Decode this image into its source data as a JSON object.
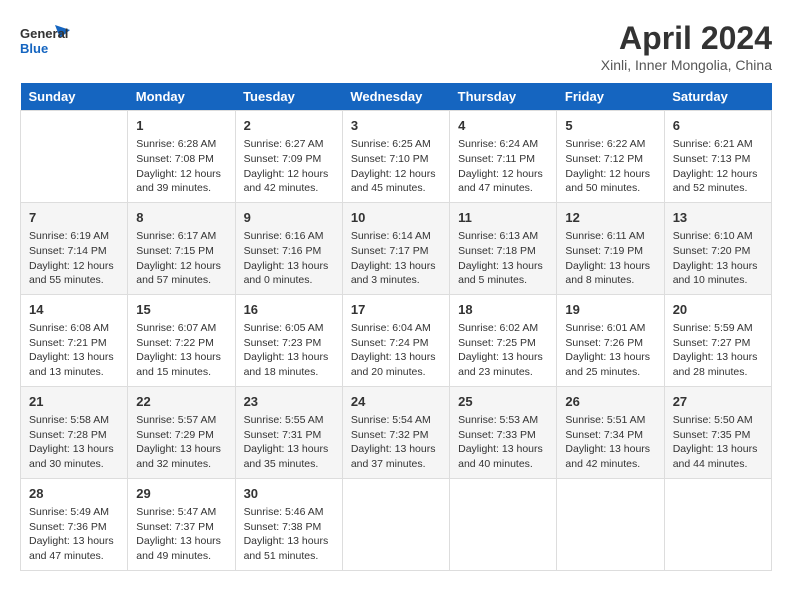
{
  "header": {
    "logo_line1": "General",
    "logo_line2": "Blue",
    "title": "April 2024",
    "subtitle": "Xinli, Inner Mongolia, China"
  },
  "days_of_week": [
    "Sunday",
    "Monday",
    "Tuesday",
    "Wednesday",
    "Thursday",
    "Friday",
    "Saturday"
  ],
  "weeks": [
    [
      {
        "day": "",
        "content": ""
      },
      {
        "day": "1",
        "content": "Sunrise: 6:28 AM\nSunset: 7:08 PM\nDaylight: 12 hours\nand 39 minutes."
      },
      {
        "day": "2",
        "content": "Sunrise: 6:27 AM\nSunset: 7:09 PM\nDaylight: 12 hours\nand 42 minutes."
      },
      {
        "day": "3",
        "content": "Sunrise: 6:25 AM\nSunset: 7:10 PM\nDaylight: 12 hours\nand 45 minutes."
      },
      {
        "day": "4",
        "content": "Sunrise: 6:24 AM\nSunset: 7:11 PM\nDaylight: 12 hours\nand 47 minutes."
      },
      {
        "day": "5",
        "content": "Sunrise: 6:22 AM\nSunset: 7:12 PM\nDaylight: 12 hours\nand 50 minutes."
      },
      {
        "day": "6",
        "content": "Sunrise: 6:21 AM\nSunset: 7:13 PM\nDaylight: 12 hours\nand 52 minutes."
      }
    ],
    [
      {
        "day": "7",
        "content": "Sunrise: 6:19 AM\nSunset: 7:14 PM\nDaylight: 12 hours\nand 55 minutes."
      },
      {
        "day": "8",
        "content": "Sunrise: 6:17 AM\nSunset: 7:15 PM\nDaylight: 12 hours\nand 57 minutes."
      },
      {
        "day": "9",
        "content": "Sunrise: 6:16 AM\nSunset: 7:16 PM\nDaylight: 13 hours\nand 0 minutes."
      },
      {
        "day": "10",
        "content": "Sunrise: 6:14 AM\nSunset: 7:17 PM\nDaylight: 13 hours\nand 3 minutes."
      },
      {
        "day": "11",
        "content": "Sunrise: 6:13 AM\nSunset: 7:18 PM\nDaylight: 13 hours\nand 5 minutes."
      },
      {
        "day": "12",
        "content": "Sunrise: 6:11 AM\nSunset: 7:19 PM\nDaylight: 13 hours\nand 8 minutes."
      },
      {
        "day": "13",
        "content": "Sunrise: 6:10 AM\nSunset: 7:20 PM\nDaylight: 13 hours\nand 10 minutes."
      }
    ],
    [
      {
        "day": "14",
        "content": "Sunrise: 6:08 AM\nSunset: 7:21 PM\nDaylight: 13 hours\nand 13 minutes."
      },
      {
        "day": "15",
        "content": "Sunrise: 6:07 AM\nSunset: 7:22 PM\nDaylight: 13 hours\nand 15 minutes."
      },
      {
        "day": "16",
        "content": "Sunrise: 6:05 AM\nSunset: 7:23 PM\nDaylight: 13 hours\nand 18 minutes."
      },
      {
        "day": "17",
        "content": "Sunrise: 6:04 AM\nSunset: 7:24 PM\nDaylight: 13 hours\nand 20 minutes."
      },
      {
        "day": "18",
        "content": "Sunrise: 6:02 AM\nSunset: 7:25 PM\nDaylight: 13 hours\nand 23 minutes."
      },
      {
        "day": "19",
        "content": "Sunrise: 6:01 AM\nSunset: 7:26 PM\nDaylight: 13 hours\nand 25 minutes."
      },
      {
        "day": "20",
        "content": "Sunrise: 5:59 AM\nSunset: 7:27 PM\nDaylight: 13 hours\nand 28 minutes."
      }
    ],
    [
      {
        "day": "21",
        "content": "Sunrise: 5:58 AM\nSunset: 7:28 PM\nDaylight: 13 hours\nand 30 minutes."
      },
      {
        "day": "22",
        "content": "Sunrise: 5:57 AM\nSunset: 7:29 PM\nDaylight: 13 hours\nand 32 minutes."
      },
      {
        "day": "23",
        "content": "Sunrise: 5:55 AM\nSunset: 7:31 PM\nDaylight: 13 hours\nand 35 minutes."
      },
      {
        "day": "24",
        "content": "Sunrise: 5:54 AM\nSunset: 7:32 PM\nDaylight: 13 hours\nand 37 minutes."
      },
      {
        "day": "25",
        "content": "Sunrise: 5:53 AM\nSunset: 7:33 PM\nDaylight: 13 hours\nand 40 minutes."
      },
      {
        "day": "26",
        "content": "Sunrise: 5:51 AM\nSunset: 7:34 PM\nDaylight: 13 hours\nand 42 minutes."
      },
      {
        "day": "27",
        "content": "Sunrise: 5:50 AM\nSunset: 7:35 PM\nDaylight: 13 hours\nand 44 minutes."
      }
    ],
    [
      {
        "day": "28",
        "content": "Sunrise: 5:49 AM\nSunset: 7:36 PM\nDaylight: 13 hours\nand 47 minutes."
      },
      {
        "day": "29",
        "content": "Sunrise: 5:47 AM\nSunset: 7:37 PM\nDaylight: 13 hours\nand 49 minutes."
      },
      {
        "day": "30",
        "content": "Sunrise: 5:46 AM\nSunset: 7:38 PM\nDaylight: 13 hours\nand 51 minutes."
      },
      {
        "day": "",
        "content": ""
      },
      {
        "day": "",
        "content": ""
      },
      {
        "day": "",
        "content": ""
      },
      {
        "day": "",
        "content": ""
      }
    ]
  ]
}
